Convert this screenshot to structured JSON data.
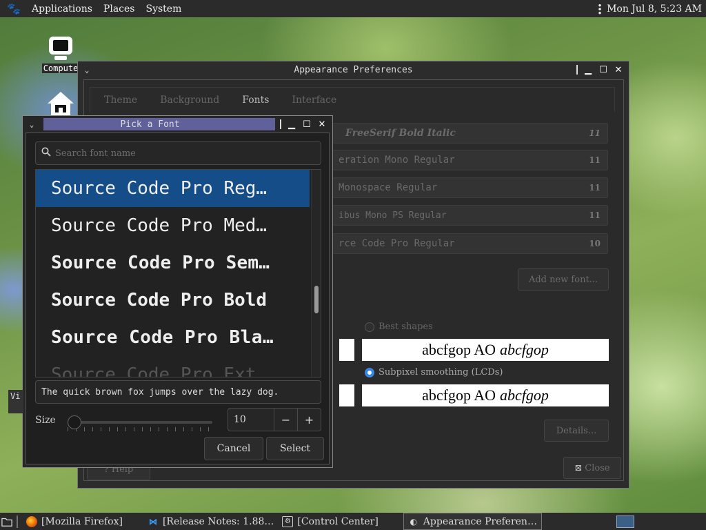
{
  "topbar": {
    "menus": [
      "Applications",
      "Places",
      "System"
    ],
    "clock": "Mon Jul  8,  5:23 AM"
  },
  "desktop": {
    "computer_label": "Compute",
    "vi_label": "Vi"
  },
  "appearance": {
    "title": "Appearance Preferences",
    "tabs": [
      "Theme",
      "Background",
      "Fonts",
      "Interface"
    ],
    "fonts": [
      {
        "name": "FreeSerif Bold Italic",
        "size": "11"
      },
      {
        "name": "eration Mono Regular",
        "size": "11"
      },
      {
        "name": "Monospace Regular",
        "size": "11"
      },
      {
        "name": "ibus Mono PS Regular",
        "size": "11"
      },
      {
        "name": "rce Code Pro Regular",
        "size": "10"
      }
    ],
    "add_font_label": "Add new font...",
    "best_shapes_label": "Best shapes",
    "subpixel_label": "Subpixel smoothing (LCDs)",
    "preview_text": "abcfgop AO",
    "preview_italic": "abcfgop",
    "details_label": "Details...",
    "help_label": "Help",
    "close_label": "Close"
  },
  "picker": {
    "title": "Pick a Font",
    "search_placeholder": "Search font name",
    "items": [
      "Source Code Pro Reg…",
      "Source Code Pro Med…",
      "Source Code Pro Sem…",
      "Source Code Pro Bold",
      "Source Code Pro Bla…",
      "Source Code Pro Ext…"
    ],
    "sample_text": "The quick brown fox jumps over the lazy dog.",
    "size_label": "Size",
    "size_value": "10",
    "cancel_label": "Cancel",
    "select_label": "Select"
  },
  "taskbar": {
    "items": [
      "[Mozilla Firefox]",
      "[Release Notes: 1.88…",
      "[Control Center]",
      "Appearance Preferen…"
    ]
  }
}
